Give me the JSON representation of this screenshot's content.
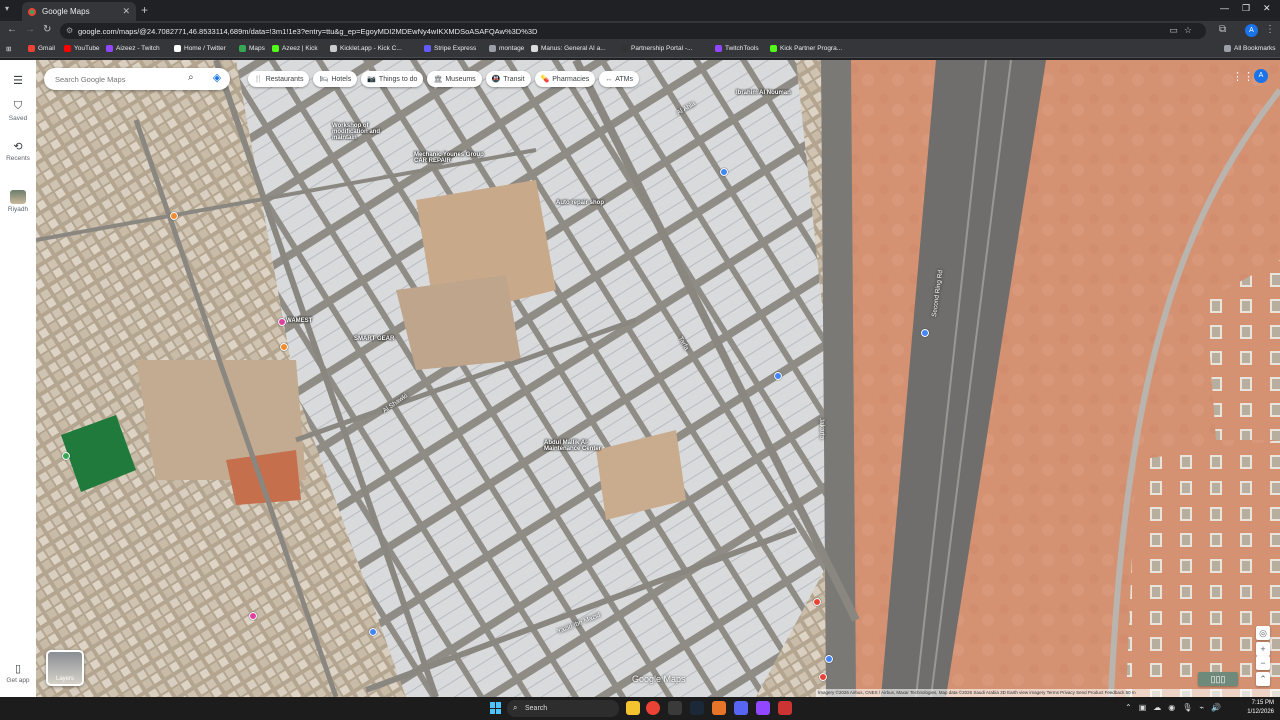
{
  "browser": {
    "tab_title": "Google Maps",
    "new_tab": "+",
    "url": "google.com/maps/@24.7082771,46.8533114,689m/data=!3m1!1e3?entry=ttu&g_ep=EgoyMDI2MDEwNy4wIKXMDSoASAFQAw%3D%3D",
    "profile_initial": "A",
    "bookmarks": [
      {
        "label": "Gmail",
        "color": "#ea4335"
      },
      {
        "label": "YouTube",
        "color": "#ff0000"
      },
      {
        "label": "Aizeez - Twitch",
        "color": "#9146ff"
      },
      {
        "label": "Home / Twitter",
        "color": "#ffffff"
      },
      {
        "label": "Maps",
        "color": "#34a853"
      },
      {
        "label": "Azeez | Kick",
        "color": "#53fc18"
      },
      {
        "label": "Kicklet.app - Kick C...",
        "color": "#cccccc"
      },
      {
        "label": "Stripe Express",
        "color": "#635bff"
      },
      {
        "label": "montage",
        "color": "#9aa0a6"
      },
      {
        "label": "Manus: General AI a...",
        "color": "#dddddd"
      },
      {
        "label": "Partnership Portal -...",
        "color": "#333333"
      },
      {
        "label": "TwitchTools",
        "color": "#9146ff"
      },
      {
        "label": "Kick Partner Progra...",
        "color": "#53fc18"
      }
    ],
    "all_bookmarks": "All Bookmarks"
  },
  "rail": {
    "saved": "Saved",
    "recents": "Recents",
    "riyadh": "Riyadh",
    "get_app": "Get app"
  },
  "search": {
    "placeholder": "Search Google Maps"
  },
  "chips": [
    {
      "label": "Restaurants",
      "icon": "🍴"
    },
    {
      "label": "Hotels",
      "icon": "🛏"
    },
    {
      "label": "Things to do",
      "icon": "📷"
    },
    {
      "label": "Museums",
      "icon": "🏛"
    },
    {
      "label": "Transit",
      "icon": "🚇"
    },
    {
      "label": "Pharmacies",
      "icon": "💊"
    },
    {
      "label": "ATMs",
      "icon": "↔"
    }
  ],
  "account_initial": "A",
  "map_labels": {
    "workshop": "Workshop of modification and maintain",
    "mechanic": "Mechanic Younes Group CAR REPAIR",
    "wamest": "WAMEST",
    "smart_gear": "SMART GEAR",
    "abdul_malik": "Abdul Mallik Al-Maintenance Center",
    "ibrahim": "Ibrahim Al Nouman",
    "tarfa": "Tarfa",
    "jakarta": "Jakarta",
    "second_ring": "Second Ring Rd",
    "al_shawki": "Al Shawki",
    "yazid": "Yazid Ibn Mazid",
    "al_ahla": "Al Ahla",
    "auto_repair": "Auto repair shop"
  },
  "layers_label": "Layers",
  "google_logo": "Google Maps",
  "attribution": "Imagery ©2026 Airbus, CNES / Airbus, Maxar Technologies, Map data ©2026   Saudi Arabia   3D Earth view imagery   Terms   Privacy   Send Product Feedback   50 m",
  "taskbar": {
    "search": "Search",
    "time": "7:15 PM",
    "date": "1/12/2026"
  }
}
